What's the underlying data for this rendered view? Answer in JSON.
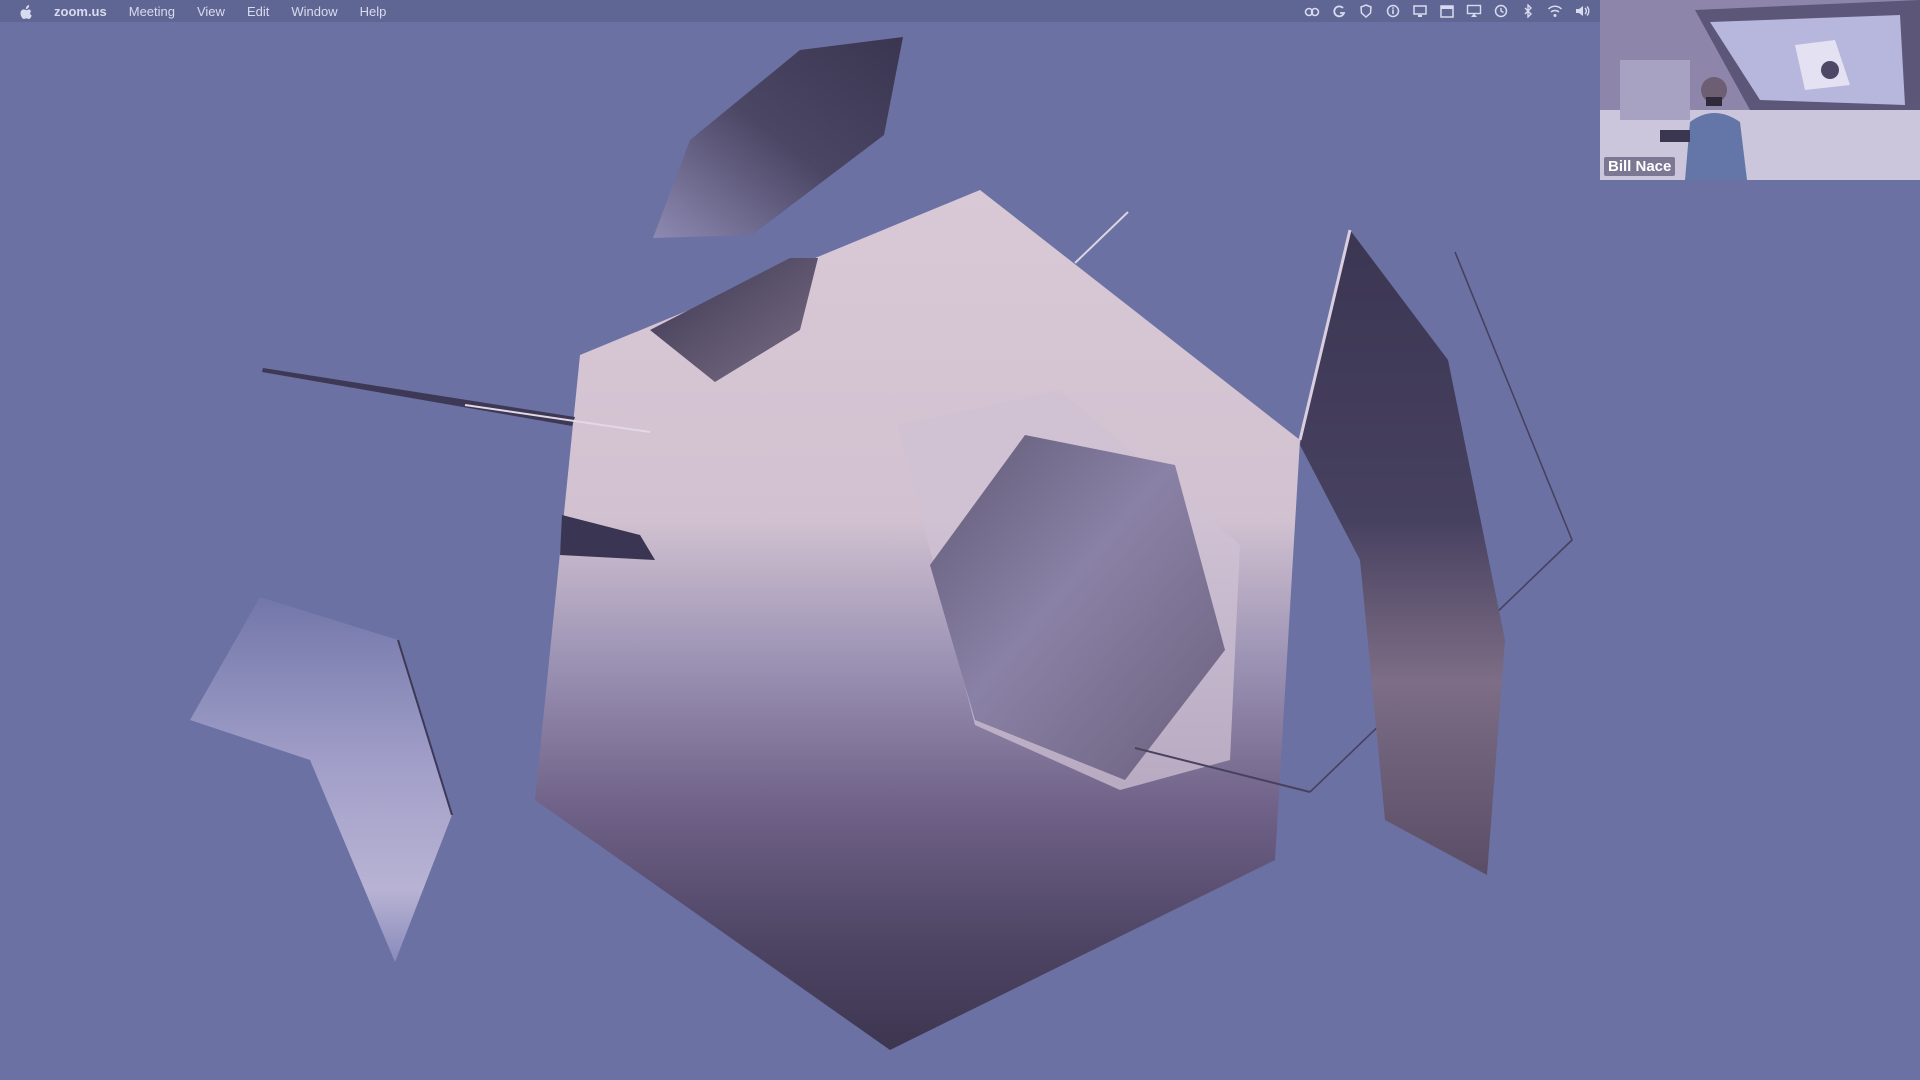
{
  "menubar": {
    "apple_icon": "apple-logo-icon",
    "app_name": "zoom.us",
    "items": [
      "Meeting",
      "View",
      "Edit",
      "Window",
      "Help"
    ]
  },
  "status_icons": [
    "creative-cloud-icon",
    "g-sync-icon",
    "shield-icon",
    "info-circle-icon",
    "screen-share-icon",
    "calendar-icon",
    "airplay-icon",
    "time-machine-icon",
    "bluetooth-icon",
    "wifi-icon",
    "volume-icon"
  ],
  "shared_screen": {
    "content": "3d-icosahedron-pieces"
  },
  "video": {
    "participant_name": "Bill Nace"
  },
  "colors": {
    "background": "#6b71a3",
    "menubar": "#5f6694",
    "face_light": "#d9c8d6",
    "face_dark": "#3a3550"
  }
}
